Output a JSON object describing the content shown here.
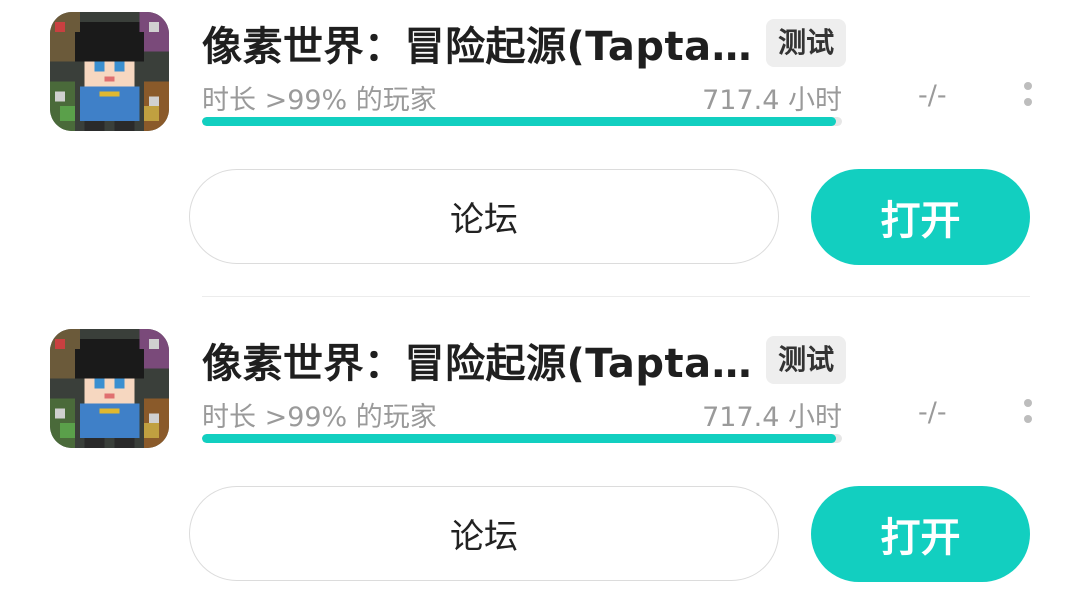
{
  "colors": {
    "accent": "#12cfc0",
    "text_primary": "#1f1f1f",
    "text_secondary": "#9a9a9a",
    "badge_bg": "#eeeeee"
  },
  "items": [
    {
      "title": "像素世界：冒险起源(Tapta…",
      "tag": "测试",
      "playtime_ratio": "时长 >99% 的玩家",
      "playtime_hours": "717.4 小时",
      "playtime_percentile": 0.99,
      "rating": "-/-",
      "forum_label": "论坛",
      "open_label": "打开",
      "icon": "pixel-character-icon",
      "more_icon": "more-vertical-icon"
    },
    {
      "title": "像素世界：冒险起源(Tapta…",
      "tag": "测试",
      "playtime_ratio": "时长 >99% 的玩家",
      "playtime_hours": "717.4 小时",
      "playtime_percentile": 0.99,
      "rating": "-/-",
      "forum_label": "论坛",
      "open_label": "打开",
      "icon": "pixel-character-icon",
      "more_icon": "more-vertical-icon"
    }
  ]
}
